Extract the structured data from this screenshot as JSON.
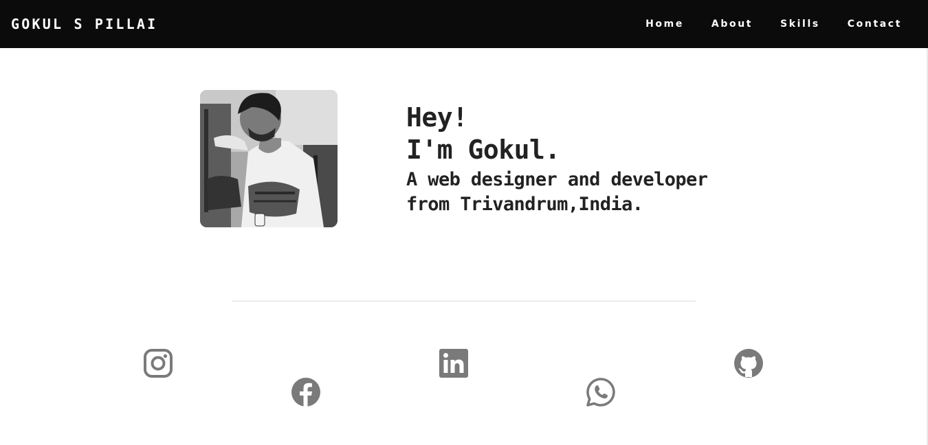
{
  "header": {
    "brand": "GOKUL S PILLAI",
    "nav": [
      "Home",
      "About",
      "Skills",
      "Contact"
    ]
  },
  "hero": {
    "greeting": "Hey!",
    "intro": "I'm Gokul.",
    "tagline_line1": "A web designer and developer",
    "tagline_line2": "from Trivandrum,India."
  },
  "social_icons": [
    "instagram-icon",
    "facebook-icon",
    "linkedin-icon",
    "whatsapp-icon",
    "github-icon"
  ],
  "colors": {
    "navbar_bg": "#0b0b0b",
    "nav_text": "#ffffff",
    "heading_text": "#222222",
    "icon_gray": "#7a7a7a",
    "divider": "#dcdcdc"
  }
}
